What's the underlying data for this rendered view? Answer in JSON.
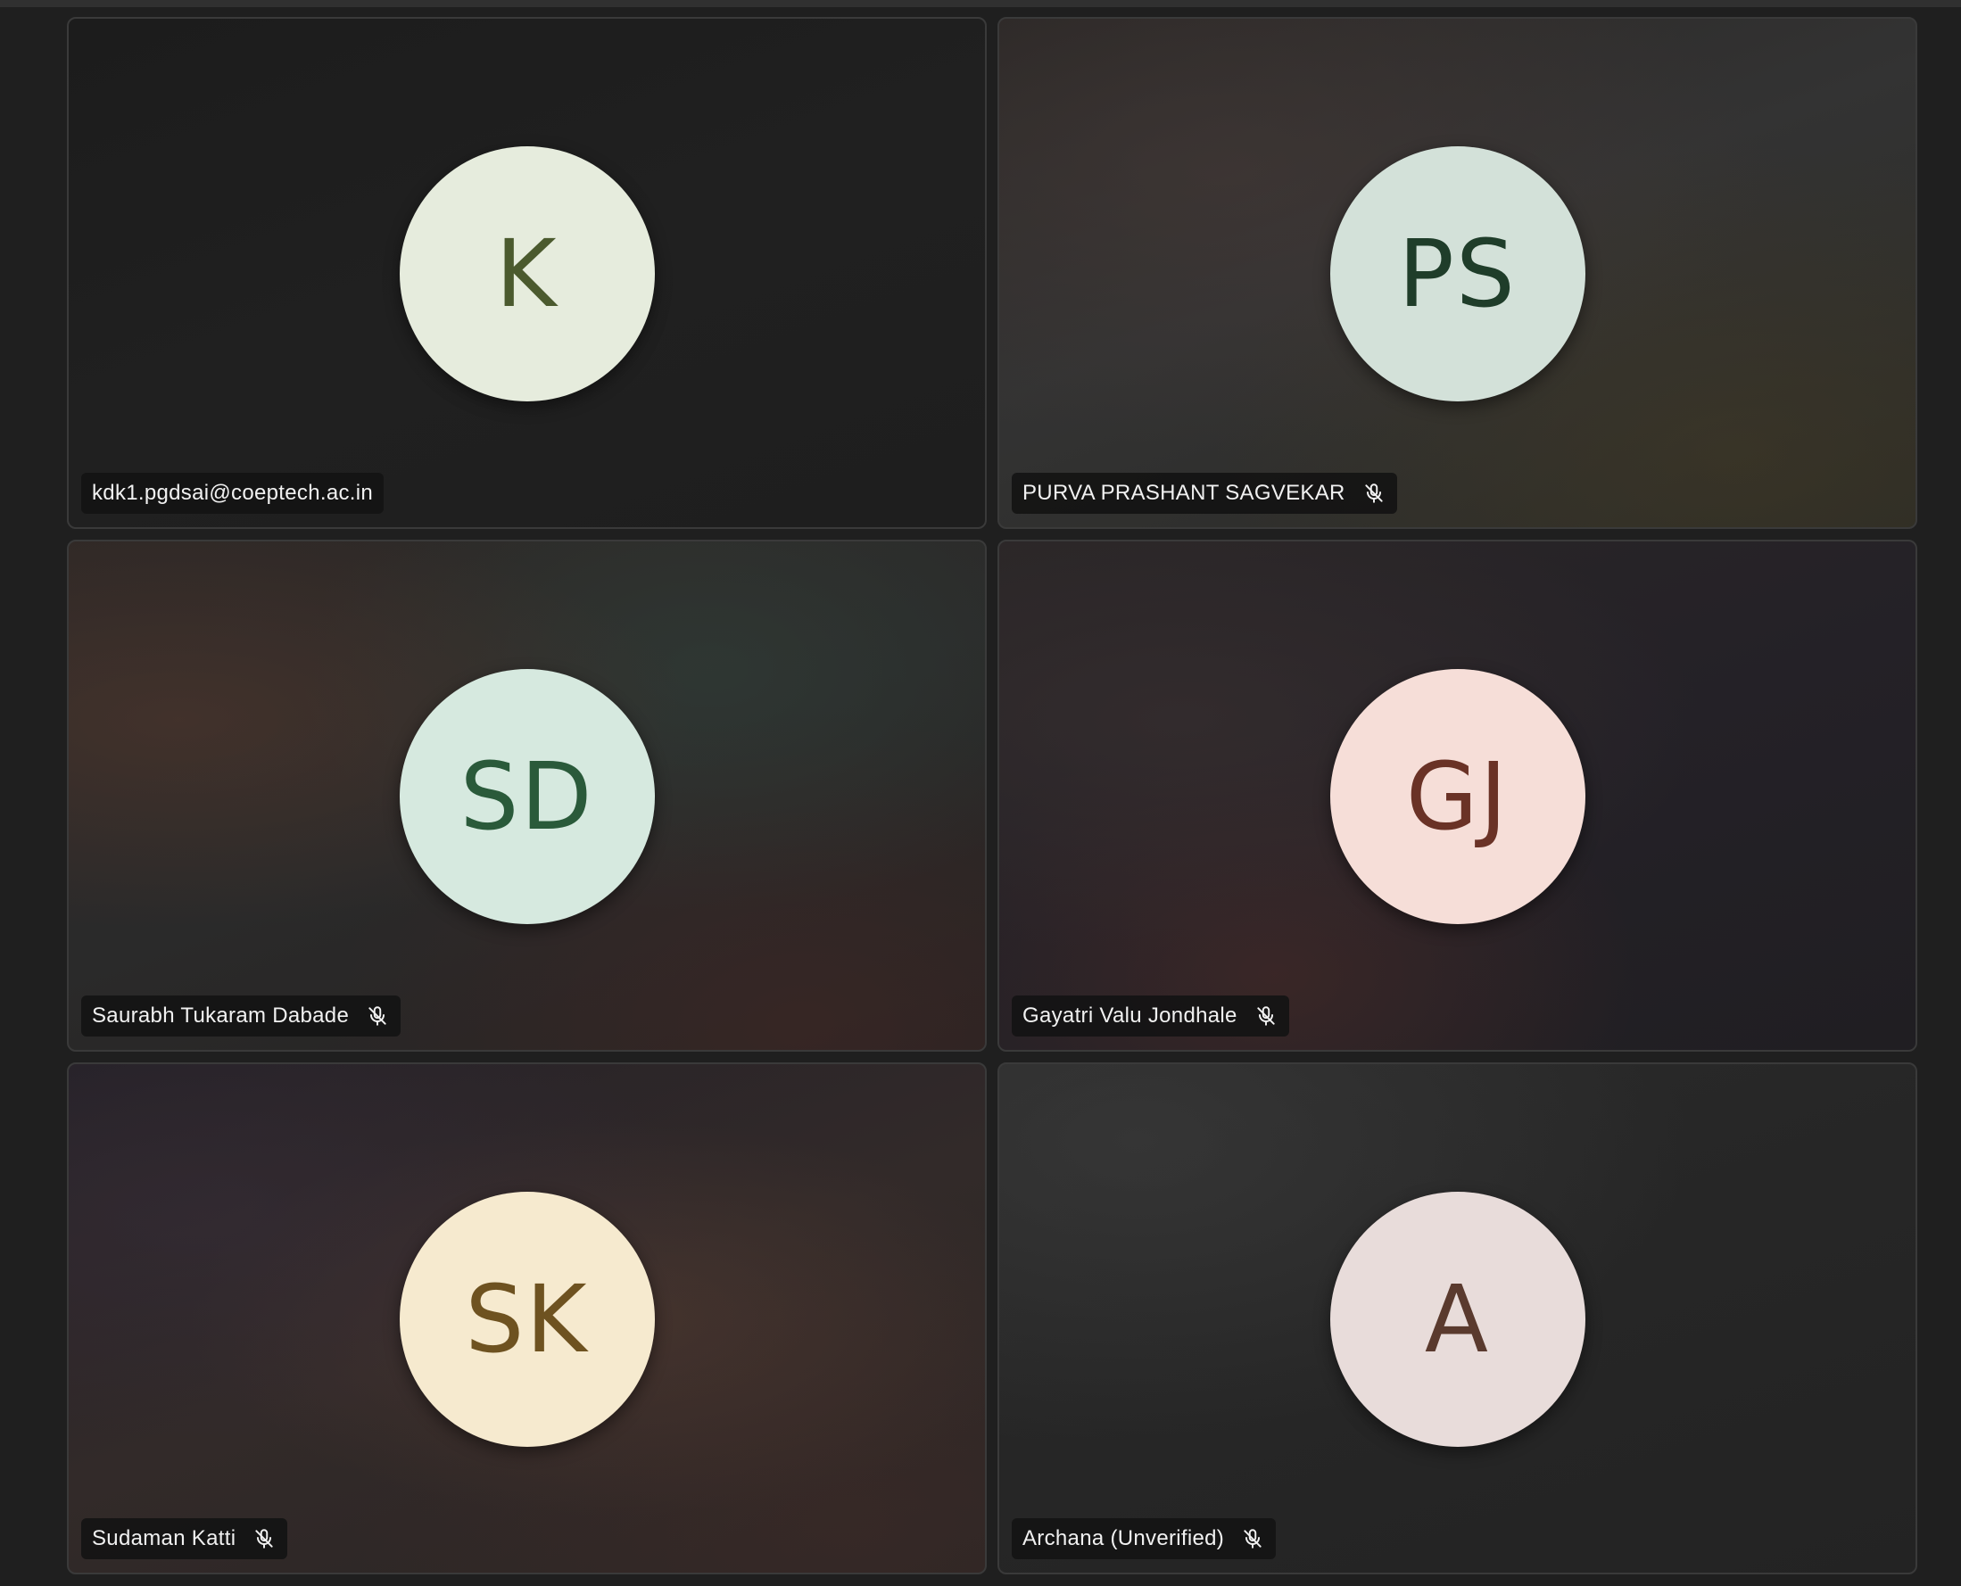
{
  "participants": [
    {
      "initials": "K",
      "name": "kdk1.pgdsai@coeptech.ac.in",
      "avatar_bg": "#e6ecdd",
      "avatar_fg": "#4b5a2e",
      "muted": false
    },
    {
      "initials": "PS",
      "name": "PURVA PRASHANT SAGVEKAR",
      "avatar_bg": "#d3e1d9",
      "avatar_fg": "#1f3d2a",
      "muted": true,
      "mic_icon": "mic-off-icon"
    },
    {
      "initials": "SD",
      "name": "Saurabh Tukaram Dabade",
      "avatar_bg": "#d6e9df",
      "avatar_fg": "#2a5a3a",
      "muted": true,
      "mic_icon": "mic-off-icon"
    },
    {
      "initials": "GJ",
      "name": "Gayatri Valu Jondhale",
      "avatar_bg": "#f6ded8",
      "avatar_fg": "#6a3226",
      "muted": true,
      "mic_icon": "mic-off-icon"
    },
    {
      "initials": "SK",
      "name": "Sudaman Katti",
      "avatar_bg": "#f6eacf",
      "avatar_fg": "#6e5220",
      "muted": true,
      "mic_icon": "mic-off-icon"
    },
    {
      "initials": "A",
      "name": "Archana (Unverified)",
      "avatar_bg": "#e8dcda",
      "avatar_fg": "#5a3a2e",
      "muted": true,
      "mic_icon": "mic-off-icon"
    }
  ]
}
